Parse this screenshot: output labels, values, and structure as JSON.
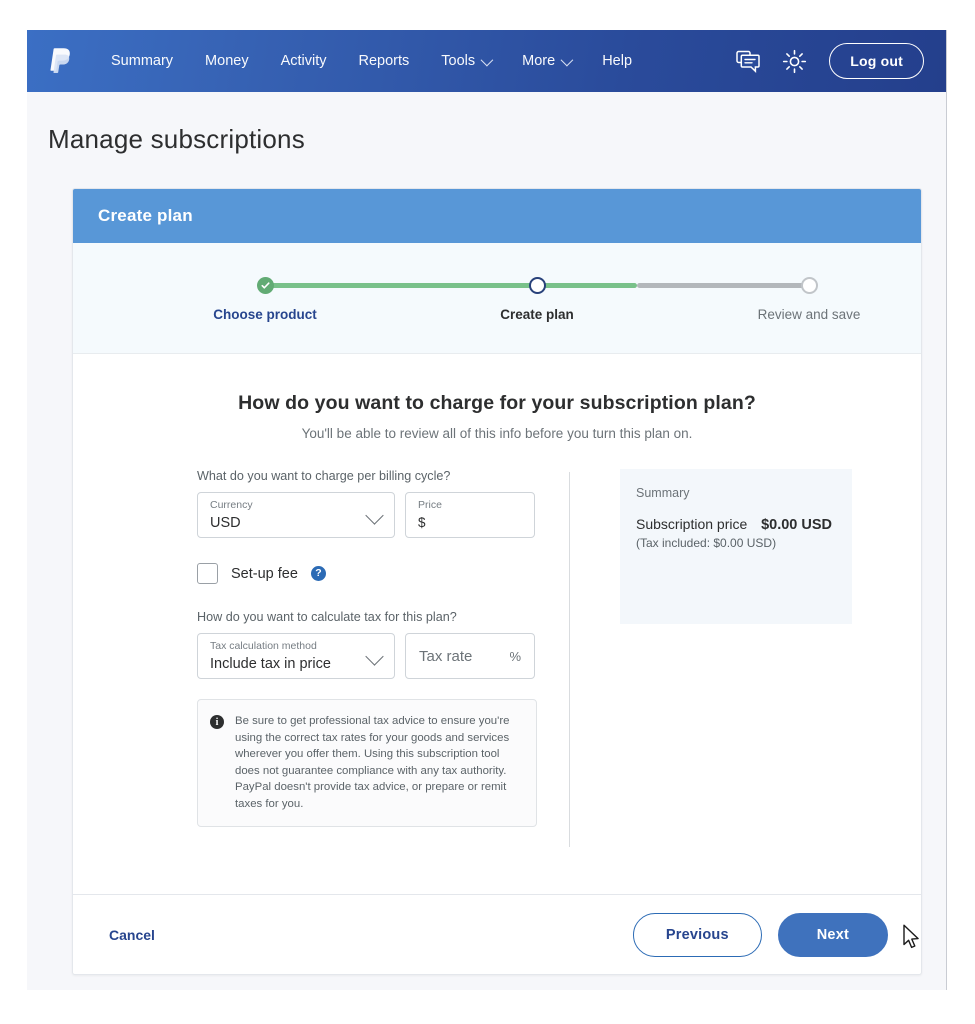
{
  "nav": {
    "logo_alt": "paypal-logo",
    "links": [
      {
        "label": "Summary",
        "caret": false
      },
      {
        "label": "Money",
        "caret": false
      },
      {
        "label": "Activity",
        "caret": false
      },
      {
        "label": "Reports",
        "caret": false
      },
      {
        "label": "Tools",
        "caret": true
      },
      {
        "label": "More",
        "caret": true
      },
      {
        "label": "Help",
        "caret": false
      }
    ],
    "message_icon": "message-icon",
    "settings_icon": "gear-icon",
    "logout_label": "Log out"
  },
  "page": {
    "title": "Manage subscriptions"
  },
  "card": {
    "header_title": "Create plan"
  },
  "stepper": {
    "steps": [
      {
        "label": "Choose product",
        "state": "complete"
      },
      {
        "label": "Create plan",
        "state": "current"
      },
      {
        "label": "Review and save",
        "state": "future"
      }
    ]
  },
  "main": {
    "headline": "How do you want to charge for your subscription plan?",
    "subhead": "You'll be able to review all of this info before you turn this plan on."
  },
  "form": {
    "billing_question": "What do you want to charge per billing cycle?",
    "currency": {
      "label": "Currency",
      "value": "USD"
    },
    "price": {
      "label": "Price",
      "value": "$"
    },
    "setup_fee": {
      "label": "Set-up fee",
      "checked": false,
      "help_icon": "question-mark-icon"
    },
    "tax_question": "How do you want to calculate tax for this plan?",
    "tax_method": {
      "label": "Tax calculation method",
      "value": "Include tax in price"
    },
    "tax_rate": {
      "placeholder": "Tax rate",
      "suffix": "%"
    },
    "notice": "Be sure to get professional tax advice to ensure you're using the correct tax rates for your goods and services wherever you offer them. Using this subscription tool does not guarantee compliance with any tax authority. PayPal doesn't provide tax advice, or prepare or remit taxes for you."
  },
  "summary": {
    "title": "Summary",
    "price_label": "Subscription price",
    "price_value": "$0.00 USD",
    "tax_note": "(Tax included: $0.00 USD)"
  },
  "footer": {
    "cancel_label": "Cancel",
    "previous_label": "Previous",
    "next_label": "Next"
  },
  "colors": {
    "nav_start": "#3b6fc4",
    "nav_end": "#243f8c",
    "card_header": "#5897d7",
    "step_done": "#79c18a",
    "step_todo": "#b3b7bb",
    "primary_button": "#3f72bd",
    "link": "#27458e",
    "summary_bg": "#f3f7fb"
  }
}
